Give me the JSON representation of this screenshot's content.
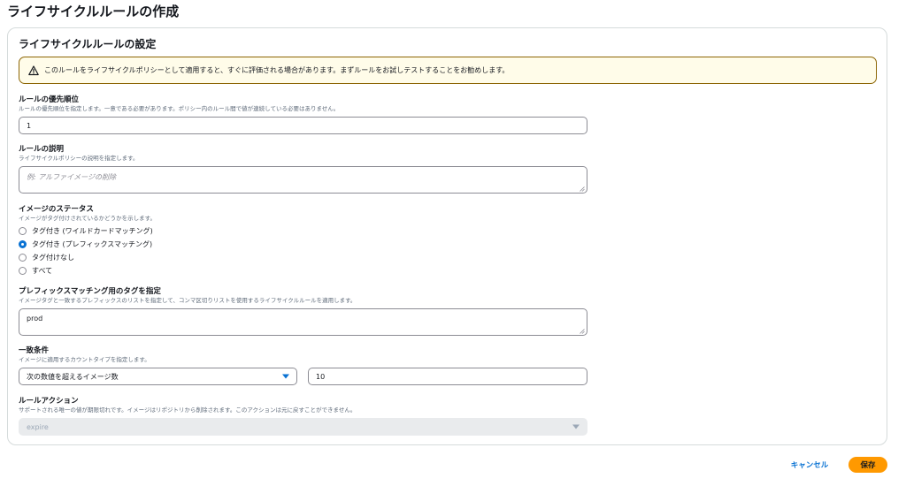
{
  "page": {
    "title": "ライフサイクルルールの作成"
  },
  "panel": {
    "title": "ライフサイクルルールの設定",
    "alert": {
      "icon": "warning-icon",
      "text": "このルールをライフサイクルポリシーとして適用すると、すぐに評価される場合があります。まずルールをお試しテストすることをお勧めします。",
      "color": "#8d6605"
    }
  },
  "priority": {
    "label": "ルールの優先順位",
    "description": "ルールの優先順位を指定します。一意である必要があります。ポリシー内のルール間で値が連続している必要はありません。",
    "value": "1"
  },
  "rule_description": {
    "label": "ルールの説明",
    "description": "ライフサイクルポリシーの説明を指定します。",
    "placeholder": "例: アルファイメージの削除",
    "value": ""
  },
  "image_status": {
    "label": "イメージのステータス",
    "description": "イメージがタグ付けされているかどうかを示します。",
    "options": [
      {
        "label": "タグ付き (ワイルドカードマッチング)",
        "checked": false
      },
      {
        "label": "タグ付き (プレフィックスマッチング)",
        "checked": true
      },
      {
        "label": "タグ付けなし",
        "checked": false
      },
      {
        "label": "すべて",
        "checked": false
      }
    ]
  },
  "prefix_tags": {
    "label": "プレフィックスマッチング用のタグを指定",
    "description": "イメージタグと一致するプレフィックスのリストを指定して、コンマ区切りリストを使用するライフサイクルルールを適用します。",
    "value": "prod"
  },
  "match_criteria": {
    "label": "一致条件",
    "description": "イメージに適用するカウントタイプを指定します。",
    "selected": "次の数値を超えるイメージ数",
    "count": "10"
  },
  "rule_action": {
    "label": "ルールアクション",
    "description": "サポートされる唯一の値が期限切れです。イメージはリポジトリから削除されます。このアクションは元に戻すことができません。",
    "selected": "expire"
  },
  "footer": {
    "cancel_label": "キャンセル",
    "save_label": "保存",
    "accent": "#ff9900",
    "link": "#0972d3"
  }
}
